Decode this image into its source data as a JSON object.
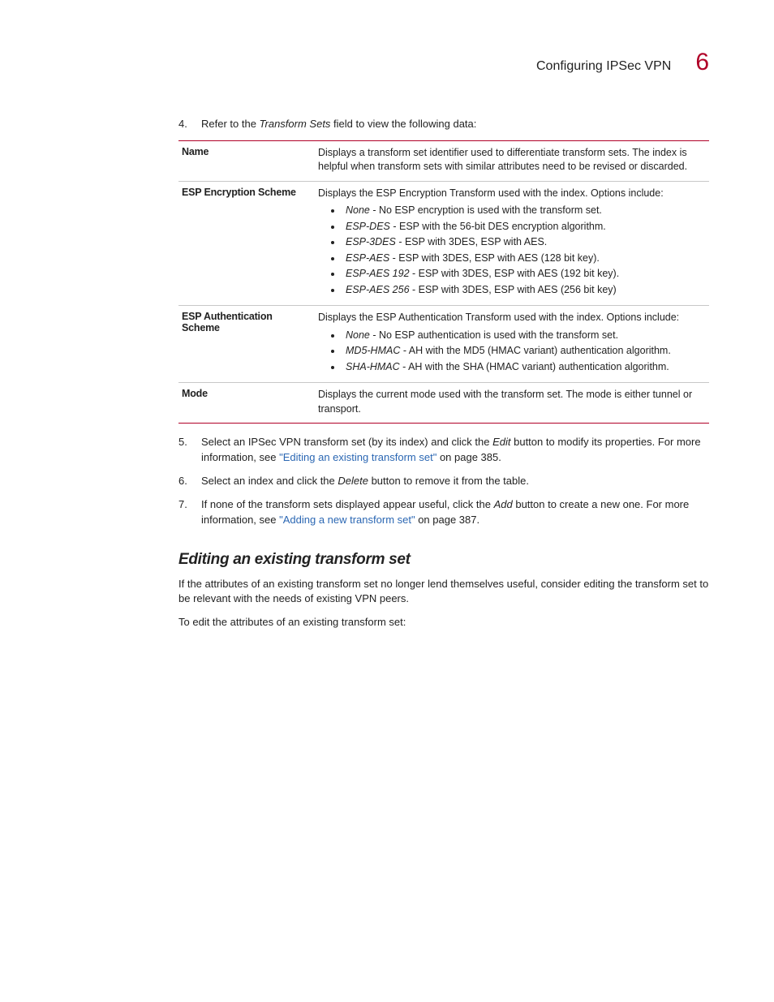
{
  "header": {
    "title": "Configuring IPSec VPN",
    "chapter": "6"
  },
  "intro_step": {
    "num": "4.",
    "pre": "Refer to the ",
    "field": "Transform Sets",
    "post": " field to view the following data:"
  },
  "table": {
    "rows": [
      {
        "label": "Name",
        "desc": "Displays a transform set identifier used to differentiate transform sets. The index is helpful when transform sets with similar attributes need to be revised or discarded."
      },
      {
        "label": "ESP Encryption Scheme",
        "desc": "Displays the ESP Encryption Transform used with the index. Options include:",
        "bullets": [
          {
            "em": "None",
            "rest": " - No ESP encryption is used with the transform set."
          },
          {
            "em": "ESP-DES",
            "rest": " - ESP with the 56-bit DES encryption algorithm."
          },
          {
            "em": "ESP-3DES",
            "rest": " - ESP with 3DES, ESP with AES."
          },
          {
            "em": "ESP-AES",
            "rest": " - ESP with 3DES, ESP with AES (128 bit key)."
          },
          {
            "em": "ESP-AES 192",
            "rest": " - ESP with 3DES, ESP with AES (192 bit key)."
          },
          {
            "em": "ESP-AES 256",
            "rest": " - ESP with 3DES, ESP with AES (256 bit key)"
          }
        ]
      },
      {
        "label": "ESP Authentication Scheme",
        "desc": "Displays the ESP Authentication Transform used with the index. Options include:",
        "bullets": [
          {
            "em": "None",
            "rest": " - No ESP authentication is used with the transform set."
          },
          {
            "em": "MD5-HMAC",
            "rest": " - AH with the MD5 (HMAC variant) authentication algorithm."
          },
          {
            "em": "SHA-HMAC",
            "rest": " - AH with the SHA (HMAC variant) authentication algorithm."
          }
        ]
      },
      {
        "label": "Mode",
        "desc": "Displays the current mode used with the transform set. The mode is either tunnel or transport."
      }
    ]
  },
  "steps_after": [
    {
      "num": "5.",
      "parts": [
        {
          "t": "Select an IPSec VPN transform set (by its index) and click the "
        },
        {
          "t": "Edit",
          "ital": true
        },
        {
          "t": " button to modify its properties. For more information, see "
        },
        {
          "t": "\"Editing an existing transform set\"",
          "link": true
        },
        {
          "t": " on page 385."
        }
      ]
    },
    {
      "num": "6.",
      "parts": [
        {
          "t": "Select an index and click the "
        },
        {
          "t": "Delete",
          "ital": true
        },
        {
          "t": " button to remove it from the table."
        }
      ]
    },
    {
      "num": "7.",
      "parts": [
        {
          "t": "If none of the transform sets displayed appear useful, click the "
        },
        {
          "t": "Add",
          "ital": true
        },
        {
          "t": " button to create a new one. For more information, see "
        },
        {
          "t": "\"Adding a new transform set\"",
          "link": true
        },
        {
          "t": " on page 387."
        }
      ]
    }
  ],
  "section": {
    "title": "Editing an existing transform set",
    "p1": "If the attributes of an existing transform set no longer lend themselves useful, consider editing the transform set to be relevant with the needs of existing VPN peers.",
    "p2": "To edit the attributes of an existing transform set:"
  }
}
